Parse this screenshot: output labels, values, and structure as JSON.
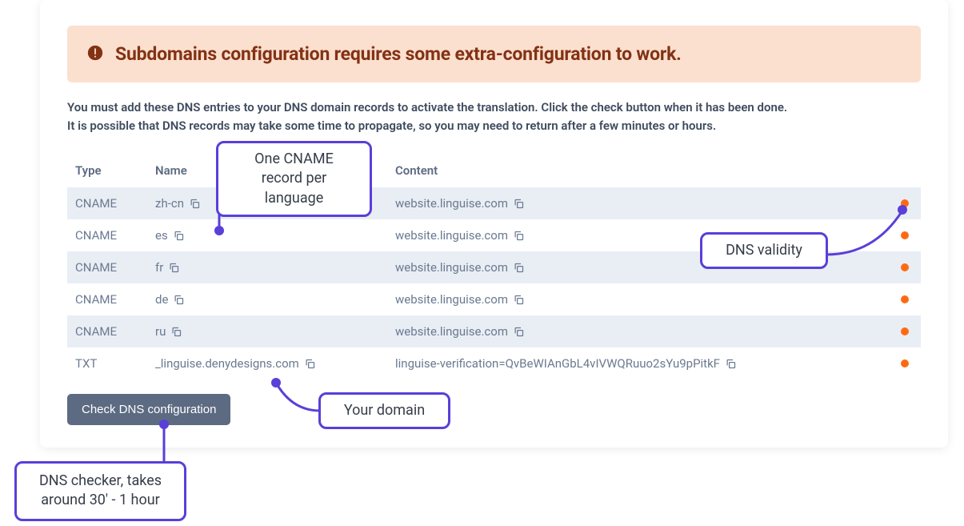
{
  "alert": {
    "text": "Subdomains configuration requires some extra-configuration to work."
  },
  "description": {
    "line1": "You must add these DNS entries to your DNS domain records to activate the translation. Click the check button when it has been done.",
    "line2": "It is possible that DNS records may take some time to propagate, so you may need to return after a few minutes or hours."
  },
  "table": {
    "headers": {
      "type": "Type",
      "name": "Name",
      "content": "Content"
    },
    "rows": [
      {
        "type": "CNAME",
        "name": "zh-cn",
        "content": "website.linguise.com",
        "status": "invalid"
      },
      {
        "type": "CNAME",
        "name": "es",
        "content": "website.linguise.com",
        "status": "invalid"
      },
      {
        "type": "CNAME",
        "name": "fr",
        "content": "website.linguise.com",
        "status": "invalid"
      },
      {
        "type": "CNAME",
        "name": "de",
        "content": "website.linguise.com",
        "status": "invalid"
      },
      {
        "type": "CNAME",
        "name": "ru",
        "content": "website.linguise.com",
        "status": "invalid"
      },
      {
        "type": "TXT",
        "name": "_linguise.denydesigns.com",
        "content": "linguise-verification=QvBeWIAnGbL4vIVWQRuuo2sYu9pPitkF",
        "status": "invalid"
      }
    ]
  },
  "button": {
    "check": "Check DNS configuration"
  },
  "callouts": {
    "cname": "One CNAME record per language",
    "validity": "DNS validity",
    "domain": "Your domain",
    "checker": "DNS checker, takes around 30' - 1 hour"
  },
  "colors": {
    "status_invalid": "#ff6a13",
    "accent": "#5a3fd9"
  }
}
